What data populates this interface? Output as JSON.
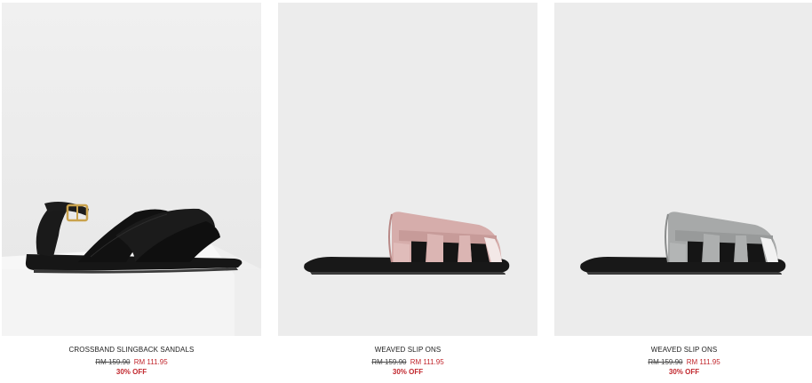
{
  "products": [
    {
      "name": "CROSSBAND SLINGBACK SANDALS",
      "old_price": "RM 159.90",
      "new_price": "RM 111.95",
      "discount": "30% OFF",
      "image": "black-crossband-slingback-sandal-image",
      "color": "#151515"
    },
    {
      "name": "WEAVED SLIP ONS",
      "old_price": "RM 159.90",
      "new_price": "RM 111.95",
      "discount": "30% OFF",
      "image": "pink-weaved-slip-on-image",
      "color": "#d9b2b0"
    },
    {
      "name": "WEAVED SLIP ONS",
      "old_price": "RM 159.90",
      "new_price": "RM 111.95",
      "discount": "30% OFF",
      "image": "grey-weaved-slip-on-image",
      "color": "#a9abab"
    }
  ],
  "colors": {
    "background": "#ffffff",
    "photo_background": "#ececec",
    "sale_red": "#c1272d"
  }
}
